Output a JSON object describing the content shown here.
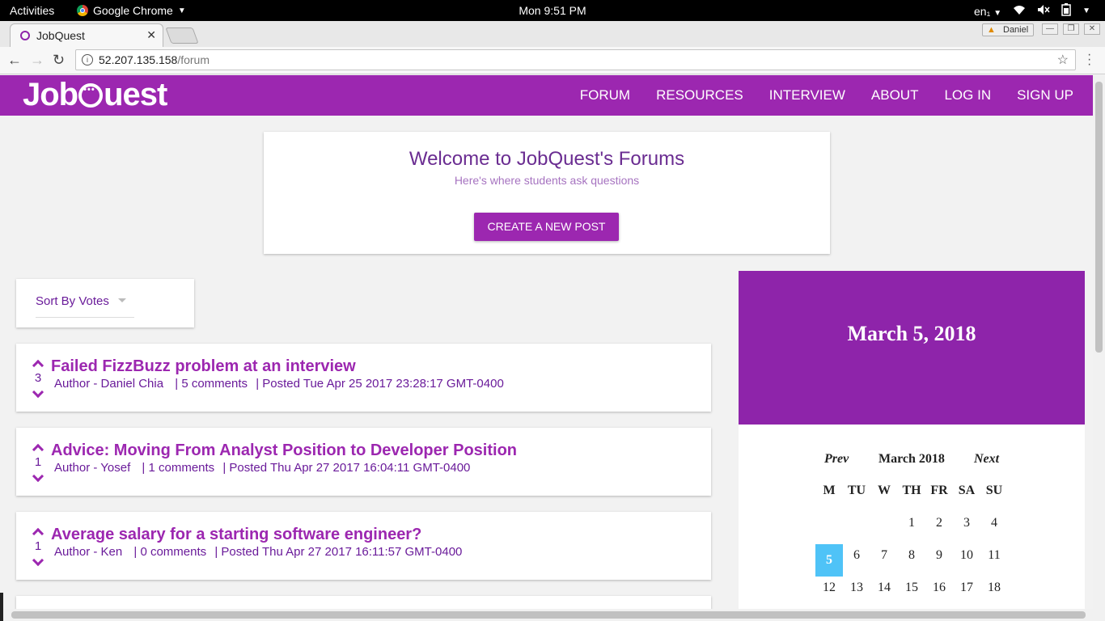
{
  "system_bar": {
    "activities": "Activities",
    "app_name": "Google Chrome",
    "clock": "Mon  9:51 PM",
    "keyboard_layout": "en₁"
  },
  "browser": {
    "tab_title": "JobQuest",
    "profile_name": "Daniel",
    "url_host": "52.207.135.158",
    "url_path": "/forum"
  },
  "site": {
    "logo_left": "Job",
    "logo_right": "uest",
    "nav": [
      "FORUM",
      "RESOURCES",
      "INTERVIEW",
      "ABOUT",
      "LOG IN",
      "SIGN UP"
    ]
  },
  "welcome": {
    "title": "Welcome to JobQuest's Forums",
    "subtitle": "Here's where students ask questions",
    "create_button": "CREATE A NEW POST"
  },
  "sort": {
    "selected": "Sort By Votes"
  },
  "posts": [
    {
      "votes": "3",
      "title": "Failed FizzBuzz problem at an interview",
      "author": "Author - Daniel Chia",
      "comments": "| 5 comments",
      "posted": "| Posted Tue Apr 25 2017 23:28:17 GMT-0400"
    },
    {
      "votes": "1",
      "title": "Advice: Moving From Analyst Position to Developer Position",
      "author": "Author - Yosef",
      "comments": "| 1 comments",
      "posted": "| Posted Thu Apr 27 2017 16:04:11 GMT-0400"
    },
    {
      "votes": "1",
      "title": "Average salary for a starting software engineer?",
      "author": "Author - Ken",
      "comments": "| 0 comments",
      "posted": "| Posted Thu Apr 27 2017 16:11:57 GMT-0400"
    }
  ],
  "calendar": {
    "selected_date": "March 5, 2018",
    "prev": "Prev",
    "month": "March 2018",
    "next": "Next",
    "weekdays": [
      "M",
      "TU",
      "W",
      "TH",
      "FR",
      "SA",
      "SU"
    ],
    "week1": [
      "1",
      "2",
      "3",
      "4"
    ],
    "week2": [
      "5",
      "6",
      "7",
      "8",
      "9",
      "10",
      "11"
    ],
    "week3": [
      "12",
      "13",
      "14",
      "15",
      "16",
      "17",
      "18"
    ]
  }
}
